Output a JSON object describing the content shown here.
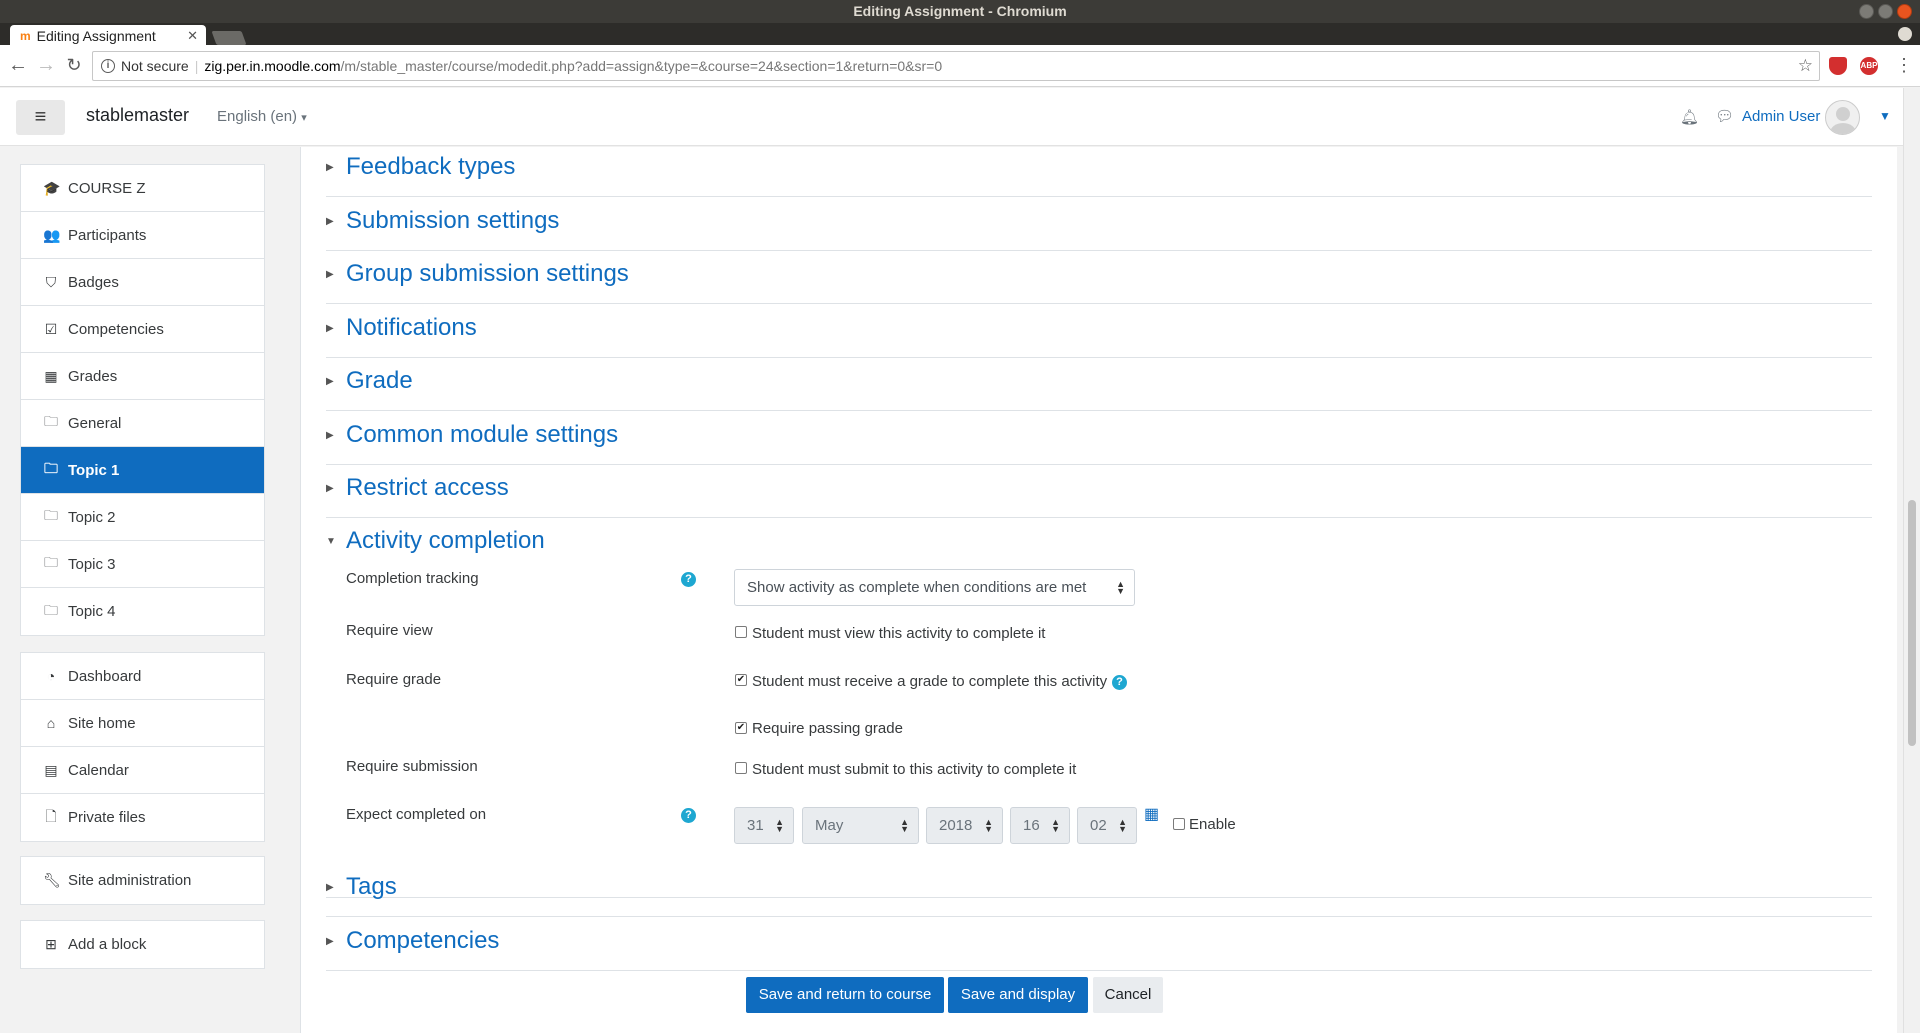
{
  "window": {
    "title": "Editing Assignment - Chromium"
  },
  "browser": {
    "tab_title": "Editing Assignment",
    "tab_favicon": "m",
    "security_label": "Not secure",
    "url_host": "zig.per.in.moodle.com",
    "url_path": "/m/stable_master/course/modedit.php?add=assign&type=&course=24&section=1&return=0&sr=0",
    "abp_label": "ABP"
  },
  "navbar": {
    "site_name": "stablemaster",
    "language": "English (en)",
    "user_name": "Admin User"
  },
  "sidebar": {
    "course_items": [
      {
        "label": "COURSE Z",
        "icon": "graduation-cap-icon",
        "glyph": "🎓"
      },
      {
        "label": "Participants",
        "icon": "users-icon",
        "glyph": "👥"
      },
      {
        "label": "Badges",
        "icon": "shield-icon",
        "glyph": "⛉"
      },
      {
        "label": "Competencies",
        "icon": "check-square-icon",
        "glyph": "☑"
      },
      {
        "label": "Grades",
        "icon": "table-icon",
        "glyph": "▦"
      },
      {
        "label": "General",
        "icon": "folder-icon",
        "glyph": "🗀"
      },
      {
        "label": "Topic 1",
        "icon": "folder-icon",
        "glyph": "🗀",
        "active": true
      },
      {
        "label": "Topic 2",
        "icon": "folder-icon",
        "glyph": "🗀"
      },
      {
        "label": "Topic 3",
        "icon": "folder-icon",
        "glyph": "🗀"
      },
      {
        "label": "Topic 4",
        "icon": "folder-icon",
        "glyph": "🗀"
      }
    ],
    "site_items": [
      {
        "label": "Dashboard",
        "icon": "tachometer-icon",
        "glyph": "◔"
      },
      {
        "label": "Site home",
        "icon": "home-icon",
        "glyph": "⌂"
      },
      {
        "label": "Calendar",
        "icon": "calendar-icon",
        "glyph": "▤"
      },
      {
        "label": "Private files",
        "icon": "file-icon",
        "glyph": "🗋"
      }
    ],
    "admin_item": {
      "label": "Site administration",
      "icon": "wrench-icon",
      "glyph": "🔧"
    },
    "block_item": {
      "label": "Add a block",
      "icon": "plus-square-icon",
      "glyph": "⊞"
    }
  },
  "sections_collapsed_top": [
    "Feedback types",
    "Submission settings",
    "Group submission settings",
    "Notifications",
    "Grade",
    "Common module settings",
    "Restrict access"
  ],
  "activity_completion": {
    "title": "Activity completion",
    "completion_tracking": {
      "label": "Completion tracking",
      "value": "Show activity as complete when conditions are met"
    },
    "require_view": {
      "label": "Require view",
      "checkbox_label": "Student must view this activity to complete it",
      "checked": false
    },
    "require_grade": {
      "label": "Require grade",
      "checkbox_label": "Student must receive a grade to complete this activity",
      "checked": true
    },
    "require_passing": {
      "checkbox_label": "Require passing grade",
      "checked": true
    },
    "require_submission": {
      "label": "Require submission",
      "checkbox_label": "Student must submit to this activity to complete it",
      "checked": false
    },
    "expect_completed": {
      "label": "Expect completed on",
      "day": "31",
      "month": "May",
      "year": "2018",
      "hour": "16",
      "minute": "02",
      "enable_label": "Enable",
      "enabled": false
    }
  },
  "sections_collapsed_bottom": [
    "Tags",
    "Competencies"
  ],
  "buttons": {
    "save_return": "Save and return to course",
    "save_display": "Save and display",
    "cancel": "Cancel"
  },
  "colors": {
    "primary": "#0f6cbf",
    "help": "#1ea7d1"
  }
}
